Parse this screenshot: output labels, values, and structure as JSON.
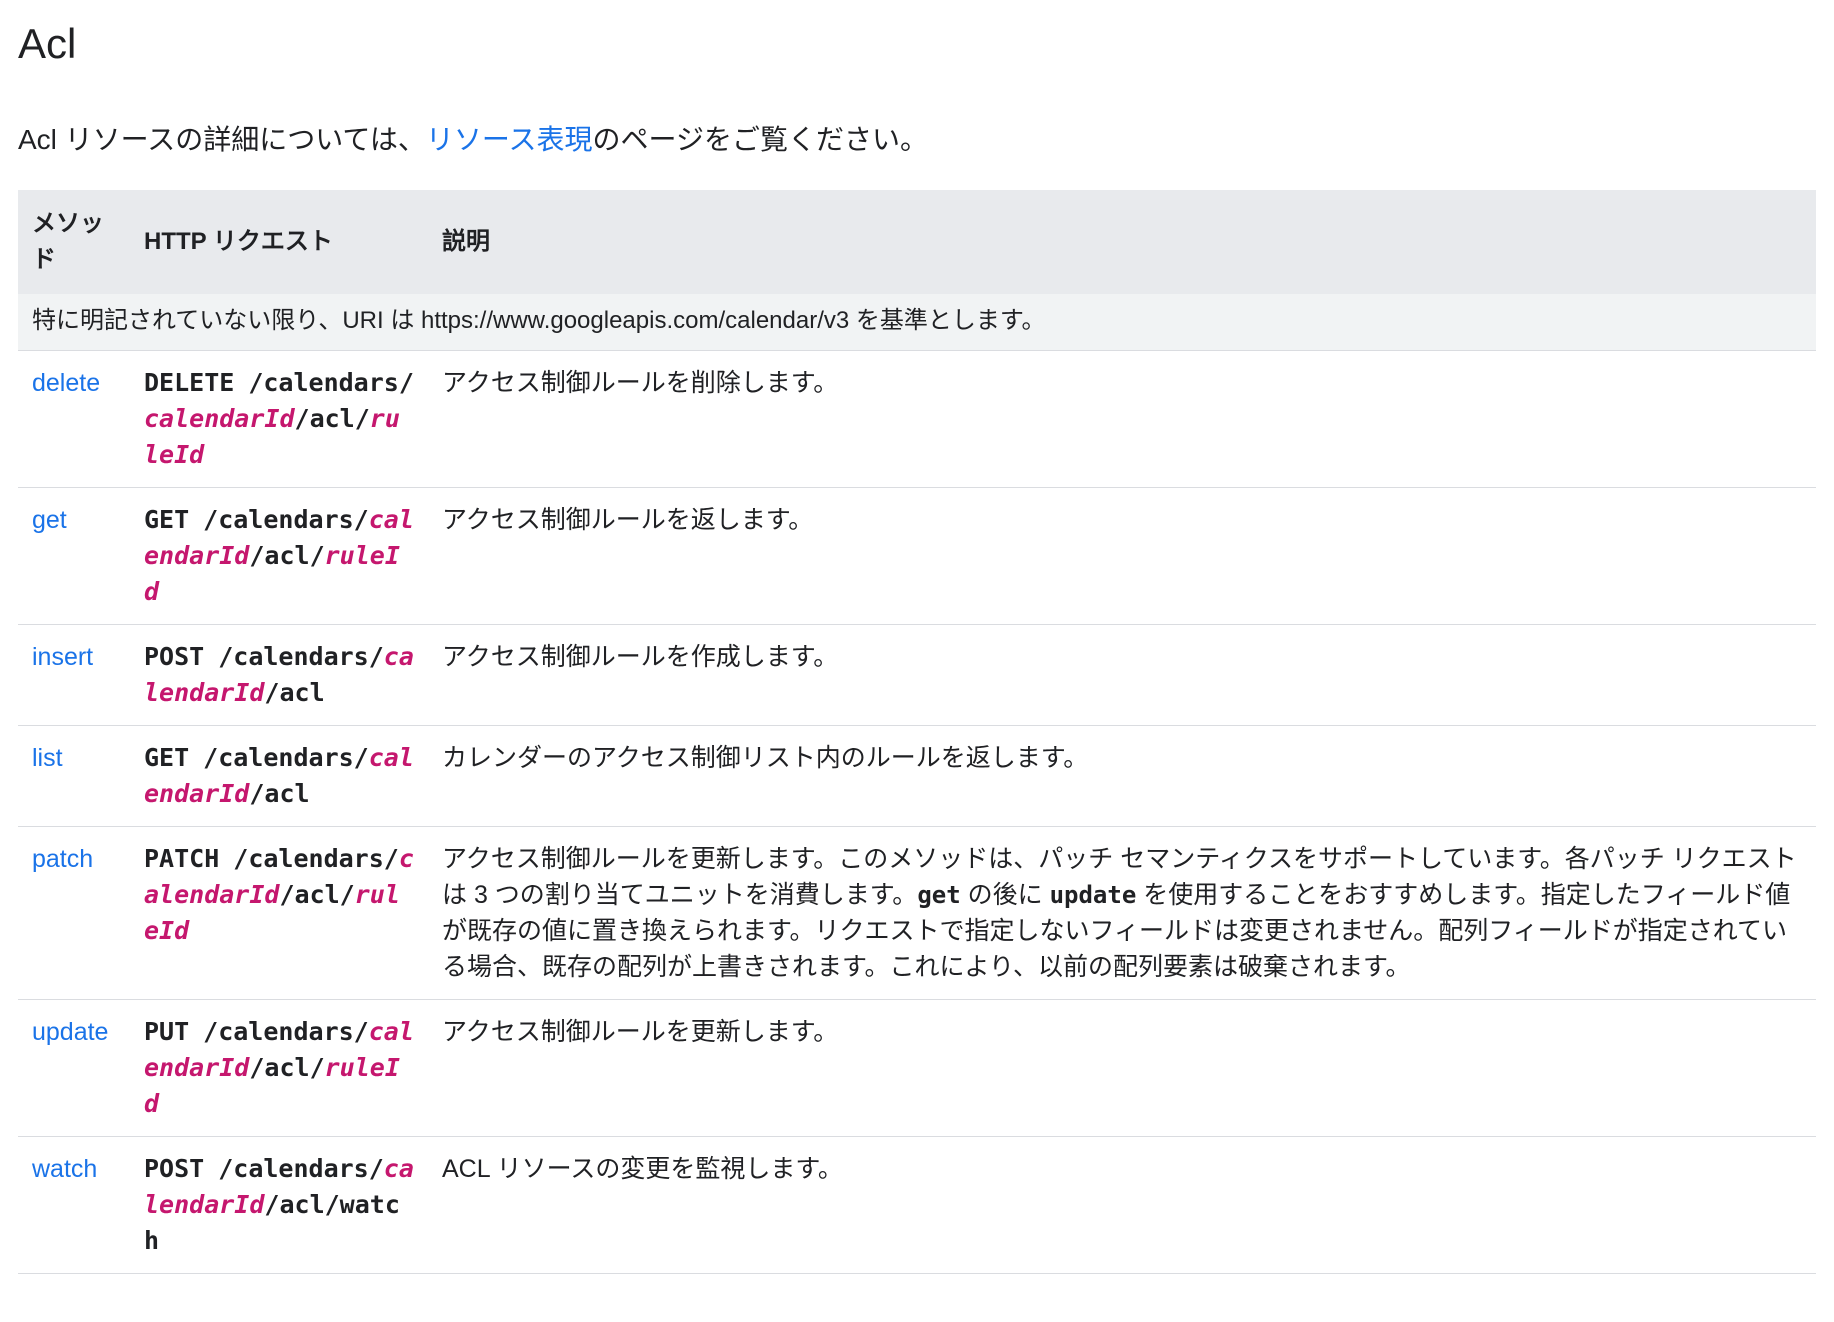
{
  "page": {
    "title": "Acl",
    "intro_prefix": "Acl リソースの詳細については、",
    "intro_link": "リソース表現",
    "intro_suffix": "のページをご覧ください。"
  },
  "table": {
    "headers": {
      "method": "メソッド",
      "http": "HTTP リクエスト",
      "desc": "説明"
    },
    "base_uri_note": "特に明記されていない限り、URI は https://www.googleapis.com/calendar/v3 を基準とします。",
    "rows": [
      {
        "method": "delete",
        "verb": "DELETE",
        "path_1": "/calendars/",
        "var_1": "calendarId",
        "path_2": "/acl/",
        "var_2": "ruleId",
        "desc": "アクセス制御ルールを削除します。"
      },
      {
        "method": "get",
        "verb": "GET",
        "path_1": "/calendars/",
        "var_1": "calendarId",
        "path_2": "/acl/",
        "var_2": "ruleId",
        "desc": "アクセス制御ルールを返します。"
      },
      {
        "method": "insert",
        "verb": "POST",
        "path_1": "/calendars/",
        "var_1": "calendarId",
        "path_2": "/acl",
        "desc": "アクセス制御ルールを作成します。"
      },
      {
        "method": "list",
        "verb": "GET",
        "path_1": "/calendars/",
        "var_1": "calendarId",
        "path_2": "/acl",
        "desc": "カレンダーのアクセス制御リスト内のルールを返します。"
      },
      {
        "method": "patch",
        "verb": "PATCH",
        "path_1": "/calendars/",
        "var_1": "calendarId",
        "path_2": "/acl/",
        "var_2": "ruleId",
        "desc_1": "アクセス制御ルールを更新します。このメソッドは、パッチ セマンティクスをサポートしています。各パッチ リクエストは 3 つの割り当てユニットを消費します。",
        "desc_code_1": "get",
        "desc_2": " の後に ",
        "desc_code_2": "update",
        "desc_3": " を使用することをおすすめします。指定したフィールド値が既存の値に置き換えられます。リクエストで指定しないフィールドは変更されません。配列フィールドが指定されている場合、既存の配列が上書きされます。これにより、以前の配列要素は破棄されます。"
      },
      {
        "method": "update",
        "verb": "PUT",
        "path_1": "/calendars/",
        "var_1": "calendarId",
        "path_2": "/acl/",
        "var_2": "ruleId",
        "desc": "アクセス制御ルールを更新します。"
      },
      {
        "method": "watch",
        "verb": "POST",
        "path_1": "/calendars/",
        "var_1": "calendarId",
        "path_2": "/acl/watch",
        "desc": "ACL リソースの変更を監視します。"
      }
    ]
  },
  "colors": {
    "link": "#1a73e8",
    "path_variable": "#c5176e",
    "header_bg": "#e8eaed",
    "base_row_bg": "#f1f3f4",
    "divider": "#dadce0"
  }
}
